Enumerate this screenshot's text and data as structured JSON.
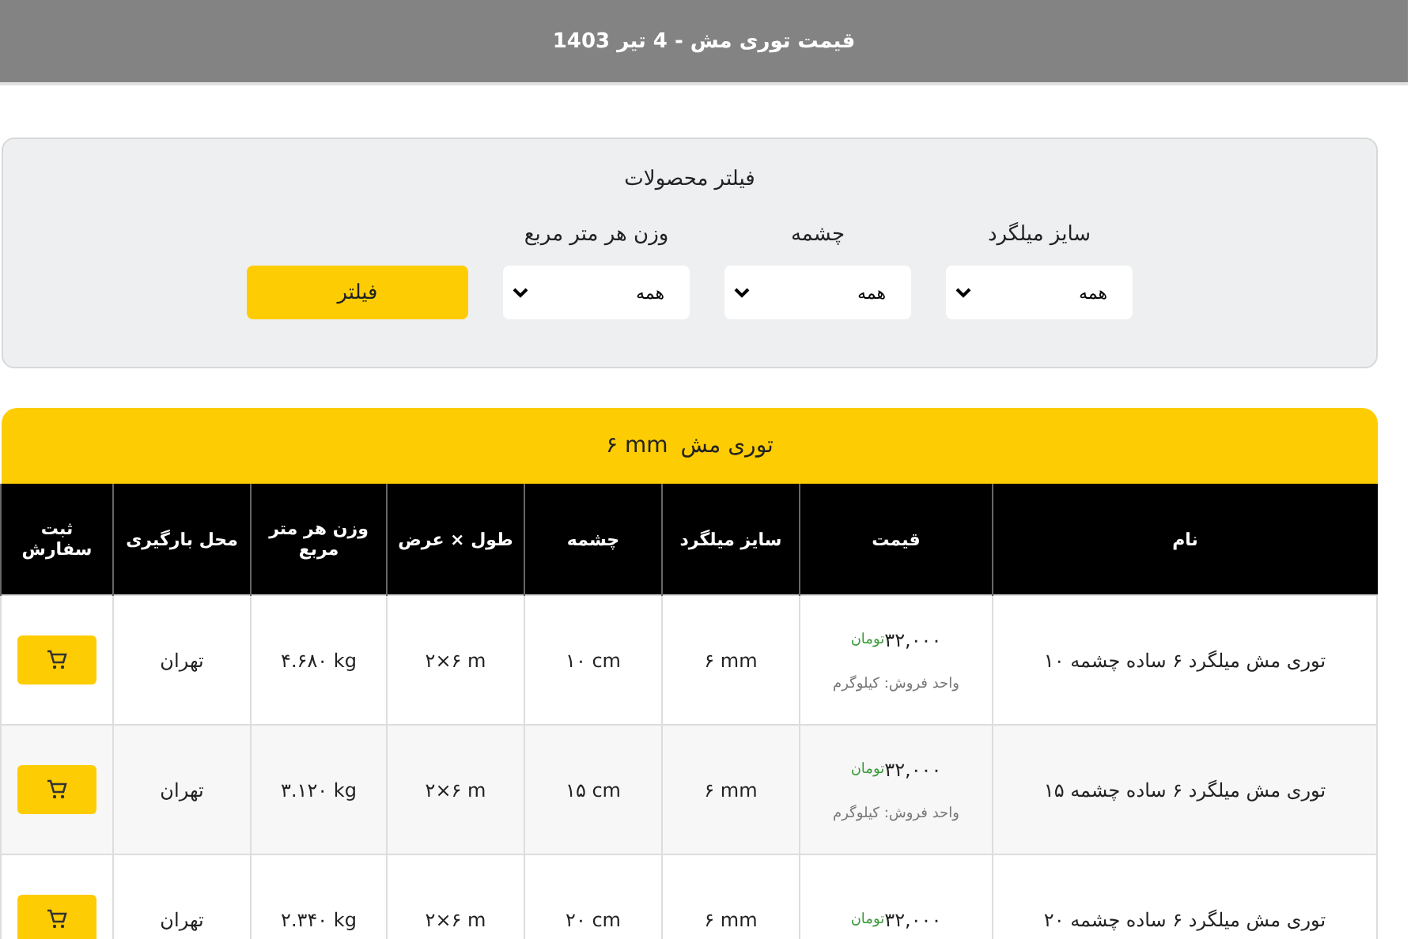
{
  "header": {
    "title": "قیمت توری مش - 4 تیر 1403"
  },
  "filter": {
    "title": "فیلتر محصولات",
    "fields": [
      {
        "label": "سایز میلگرد",
        "value": "همه"
      },
      {
        "label": "چشمه",
        "value": "همه"
      },
      {
        "label": "وزن هر متر مربع",
        "value": "همه"
      }
    ],
    "button": "فیلتر"
  },
  "table": {
    "title": "توری مش",
    "size": "۶ mm",
    "columns": [
      "نام",
      "قیمت",
      "سایز میلگرد",
      "چشمه",
      "طول × عرض",
      "وزن هر متر مربع",
      "محل بارگیری",
      "ثبت سفارش"
    ],
    "rows": [
      {
        "name": "توری مش میلگرد ۶ ساده چشمه ۱۰",
        "price": "۳۲,۰۰۰",
        "currency": "تومان",
        "unit": "واحد فروش: کیلوگرم",
        "rebar": "۶ mm",
        "mesh": "۱۰ cm",
        "dims": "۲×۶ m",
        "weight": "۴.۶۸۰ kg",
        "location": "تهران"
      },
      {
        "name": "توری مش میلگرد ۶ ساده چشمه ۱۵",
        "price": "۳۲,۰۰۰",
        "currency": "تومان",
        "unit": "واحد فروش: کیلوگرم",
        "rebar": "۶ mm",
        "mesh": "۱۵ cm",
        "dims": "۲×۶ m",
        "weight": "۳.۱۲۰ kg",
        "location": "تهران"
      },
      {
        "name": "توری مش میلگرد ۶ ساده چشمه ۲۰",
        "price": "۳۲,۰۰۰",
        "currency": "تومان",
        "rebar": "۶ mm",
        "mesh": "۲۰ cm",
        "dims": "۲×۶ m",
        "weight": "۲.۳۴۰ kg",
        "location": "تهران"
      }
    ]
  }
}
